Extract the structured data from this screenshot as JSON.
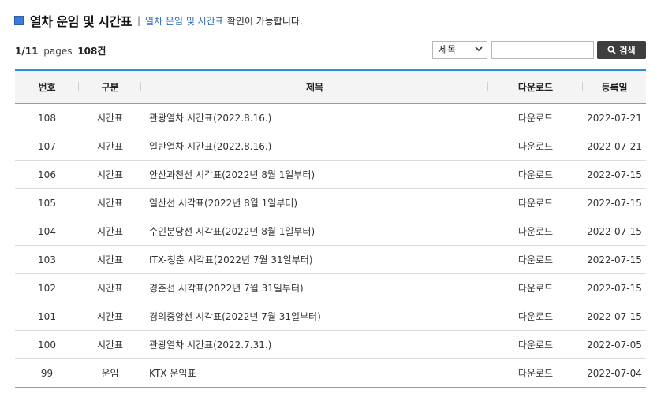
{
  "header": {
    "title": "열차 운임 및 시간표",
    "separator": "|",
    "subtitle_link": "열차 운임 및 시간표",
    "subtitle_rest": "확인이 가능합니다."
  },
  "pager": {
    "current": "1/11",
    "pages_word": "pages",
    "count": "108건"
  },
  "search": {
    "select_value": "제목",
    "input_value": "",
    "button_label": "검색",
    "button_icon": "search-icon"
  },
  "table": {
    "columns": [
      "번호",
      "구분",
      "제목",
      "다운로드",
      "등록일"
    ],
    "rows": [
      {
        "num": "108",
        "category": "시간표",
        "title": "관광열차 시간표(2022.8.16.)",
        "download": "다운로드",
        "date": "2022-07-21"
      },
      {
        "num": "107",
        "category": "시간표",
        "title": "일반열차 시간표(2022.8.16.)",
        "download": "다운로드",
        "date": "2022-07-21"
      },
      {
        "num": "106",
        "category": "시간표",
        "title": "안산과천선 시각표(2022년 8월 1일부터)",
        "download": "다운로드",
        "date": "2022-07-15"
      },
      {
        "num": "105",
        "category": "시간표",
        "title": "일산선 시각표(2022년 8월 1일부터)",
        "download": "다운로드",
        "date": "2022-07-15"
      },
      {
        "num": "104",
        "category": "시간표",
        "title": "수인분당선 시각표(2022년 8월 1일부터)",
        "download": "다운로드",
        "date": "2022-07-15"
      },
      {
        "num": "103",
        "category": "시간표",
        "title": "ITX-청춘 시각표(2022년 7월 31일부터)",
        "download": "다운로드",
        "date": "2022-07-15"
      },
      {
        "num": "102",
        "category": "시간표",
        "title": "경춘선 시각표(2022년 7월 31일부터)",
        "download": "다운로드",
        "date": "2022-07-15"
      },
      {
        "num": "101",
        "category": "시간표",
        "title": "경의중앙선 시각표(2022년 7월 31일부터)",
        "download": "다운로드",
        "date": "2022-07-15"
      },
      {
        "num": "100",
        "category": "시간표",
        "title": "관광열차 시간표(2022.7.31.)",
        "download": "다운로드",
        "date": "2022-07-05"
      },
      {
        "num": "99",
        "category": "운임",
        "title": "KTX 운임표",
        "download": "다운로드",
        "date": "2022-07-04"
      }
    ]
  }
}
